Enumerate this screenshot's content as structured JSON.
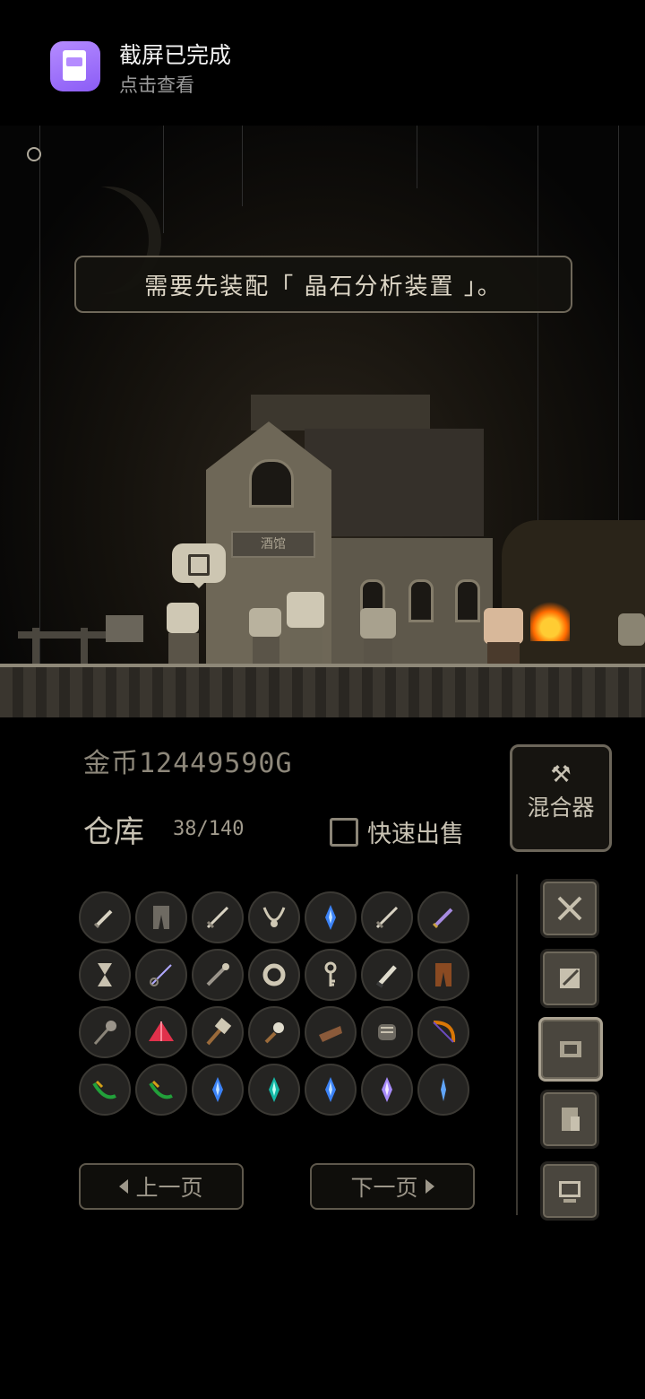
{
  "notification": {
    "title": "截屏已完成",
    "subtitle": "点击查看",
    "icon": "screenshot-icon"
  },
  "scene": {
    "message": "需要先装配「 晶石分析装置 」。",
    "tavern_sign": "酒馆"
  },
  "panel": {
    "gold": "金币12449590G",
    "warehouse_label": "仓库",
    "capacity": "38/140",
    "quick_sell_label": "快速出售",
    "quick_sell_checked": false,
    "mixer_label": "混合器",
    "prev_page": "上一页",
    "next_page": "下一页"
  },
  "inventory": [
    [
      "dagger",
      "pants",
      "sword",
      "necklace",
      "blue-crystal",
      "sword",
      "purple-dagger"
    ],
    [
      "hourglass",
      "rapier",
      "staff",
      "ring",
      "key",
      "knife",
      "brown-pants"
    ],
    [
      "mace",
      "red-pyramid",
      "hammer",
      "morningstar",
      "bracer",
      "gauntlet",
      "bow"
    ],
    [
      "green-bow",
      "green-bow",
      "blue-crystal",
      "teal-crystal",
      "blue-crystal",
      "violet-crystal",
      "blue-shard"
    ]
  ],
  "side_tabs": [
    "swords-icon",
    "scroll-icon",
    "armor-icon",
    "document-icon",
    "computer-icon"
  ],
  "active_side_tab": 2,
  "colors": {
    "panel_bg": "#000000",
    "slot_bg": "#252422",
    "accent_fire": "#ff6a00"
  }
}
